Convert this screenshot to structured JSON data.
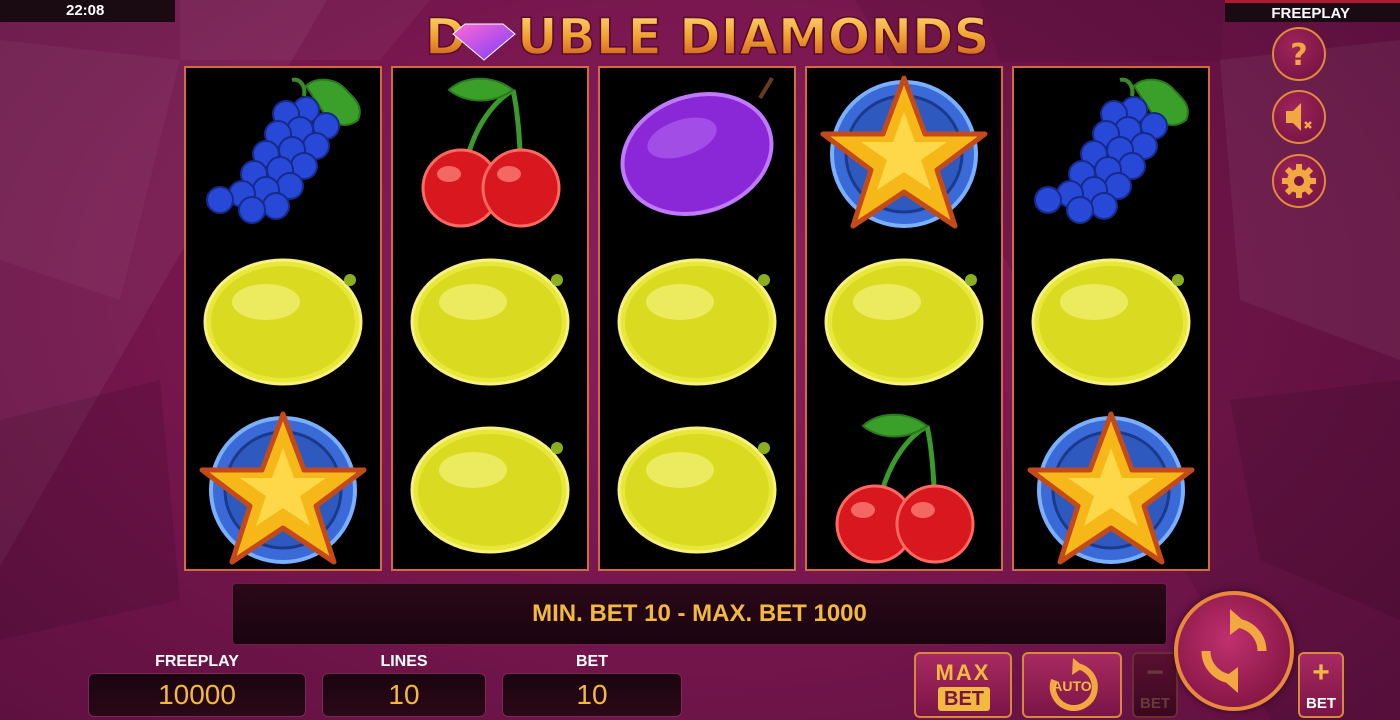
{
  "status_bar": {
    "time": "22:08",
    "mode": "FREEPLAY"
  },
  "game": {
    "title": "DOUBLE DIAMONDS"
  },
  "reels": [
    [
      "grapes-icon",
      "lemon-icon",
      "star-icon"
    ],
    [
      "cherries-icon",
      "lemon-icon",
      "lemon-icon"
    ],
    [
      "plum-icon",
      "lemon-icon",
      "lemon-icon"
    ],
    [
      "star-icon",
      "lemon-icon",
      "cherries-icon"
    ],
    [
      "grapes-icon",
      "lemon-icon",
      "star-icon"
    ]
  ],
  "side_buttons": [
    "help-icon",
    "sound-muted-icon",
    "gear-icon"
  ],
  "info_message": "MIN. BET 10 - MAX. BET 1000",
  "counters": {
    "credit": {
      "label": "FREEPLAY",
      "value": "10000"
    },
    "lines": {
      "label": "LINES",
      "value": "10"
    },
    "bet": {
      "label": "BET",
      "value": "10"
    }
  },
  "controls": {
    "max_bet_top": "MAX",
    "max_bet_bottom": "BET",
    "auto": "AUTO",
    "bet_minus_sign": "−",
    "bet_minus_label": "BET",
    "bet_plus_sign": "+",
    "bet_plus_label": "BET"
  },
  "colors": {
    "accent_gold": "#f2b940",
    "frame_orange": "#d4693a",
    "background": "#7a1750"
  }
}
